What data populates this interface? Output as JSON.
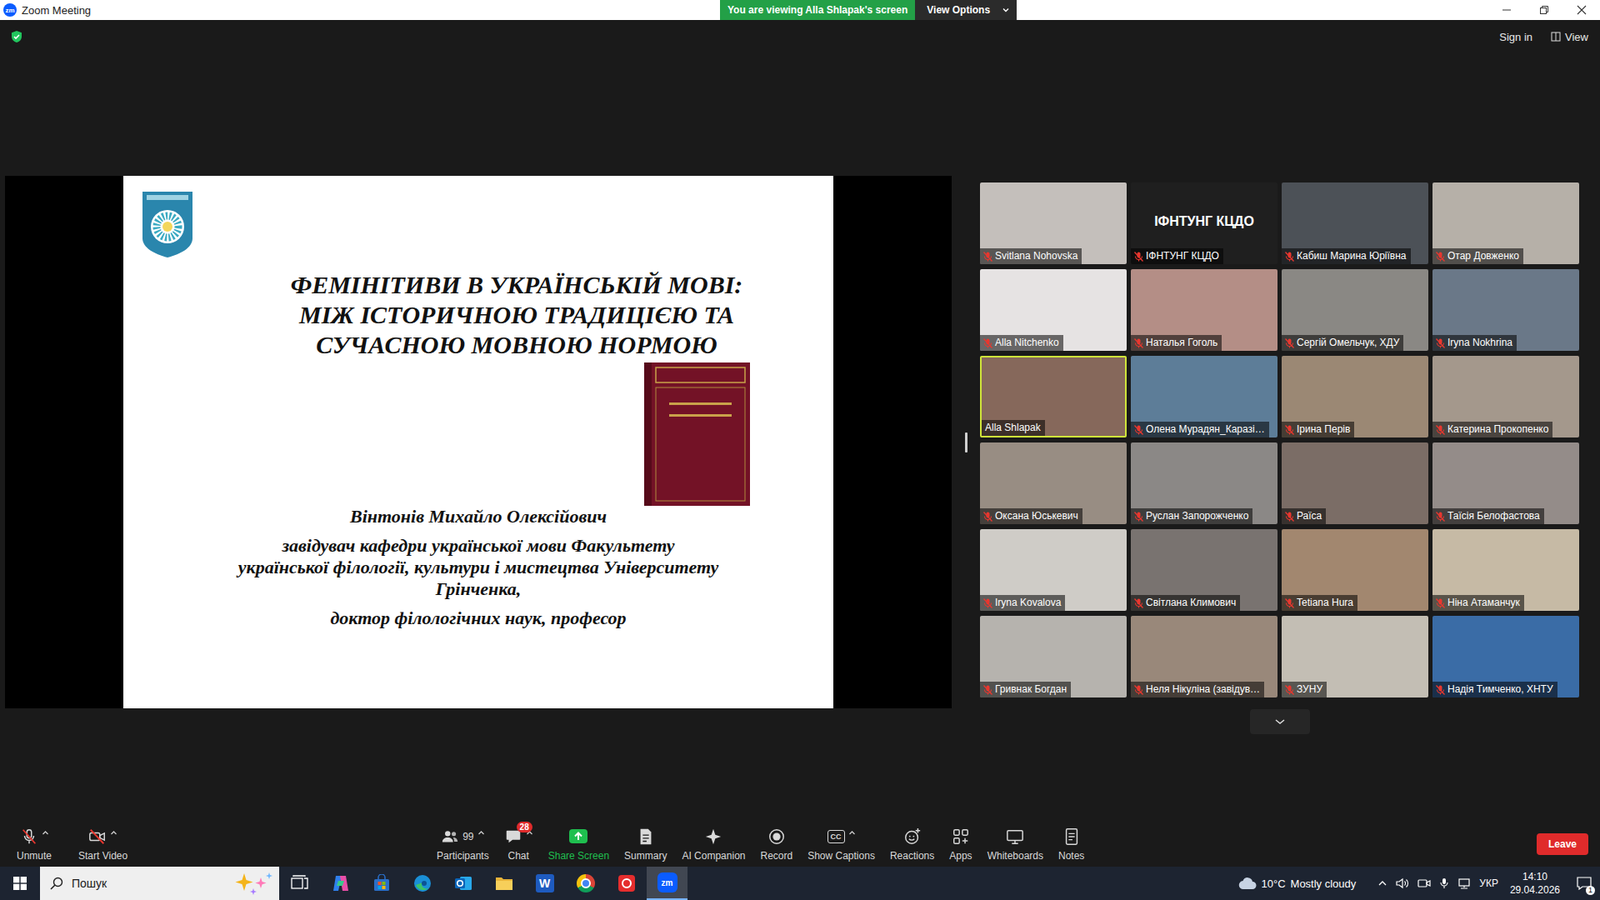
{
  "window": {
    "title": "Zoom Meeting",
    "app_icon": "zm"
  },
  "banner": {
    "text": "You are viewing Alla Shlapak's screen",
    "button": "View Options"
  },
  "top_right": {
    "sign_in": "Sign in",
    "view": "View"
  },
  "slide": {
    "title_lines": [
      "ФЕМІНІТИВИ В УКРАЇНСЬКІЙ МОВІ:",
      "МІЖ ІСТОРИЧНОЮ ТРАДИЦІЄЮ ТА",
      "СУЧАСНОЮ МОВНОЮ НОРМОЮ"
    ],
    "author": "Вінтонів Михайло Олексійович",
    "position_lines": [
      "завідувач кафедри української мови Факультету",
      "української філології, культури і мистецтва Університету",
      "Грінченка,"
    ],
    "degree": "доктор філологічних наук, професор"
  },
  "participants": [
    {
      "name": "Svitlana Nohovska",
      "muted": true,
      "video": true,
      "selected": false,
      "color": "#c4bfbb"
    },
    {
      "name": "ІФНТУНГ КЦДО",
      "muted": true,
      "video": false,
      "selected": false,
      "color": "#1f1f1f"
    },
    {
      "name": "Кабиш Марина Юріївна",
      "muted": true,
      "video": true,
      "selected": false,
      "color": "#4c5157"
    },
    {
      "name": "Отар Довженко",
      "muted": true,
      "video": true,
      "selected": false,
      "color": "#b6b0a8"
    },
    {
      "name": "Alla Nitchenko",
      "muted": true,
      "video": true,
      "selected": false,
      "color": "#e6e3e3"
    },
    {
      "name": "Наталья Гоголь",
      "muted": true,
      "video": true,
      "selected": false,
      "color": "#b48e86"
    },
    {
      "name": "Сергій Омельчук, ХДУ",
      "muted": true,
      "video": true,
      "selected": false,
      "color": "#8a8884"
    },
    {
      "name": "Iryna Nokhrina",
      "muted": true,
      "video": true,
      "selected": false,
      "color": "#6a7888"
    },
    {
      "name": "Alla Shlapak",
      "muted": false,
      "video": true,
      "selected": true,
      "color": "#86685b"
    },
    {
      "name": "Олена Мурадян_Каразі…",
      "muted": true,
      "video": true,
      "selected": false,
      "color": "#5d7d98"
    },
    {
      "name": "Ірина Перів",
      "muted": true,
      "video": true,
      "selected": false,
      "color": "#9b8874"
    },
    {
      "name": "Катерина Прокопенко",
      "muted": true,
      "video": true,
      "selected": false,
      "color": "#a4988c"
    },
    {
      "name": "Оксана Юськевич",
      "muted": true,
      "video": true,
      "selected": false,
      "color": "#988d83"
    },
    {
      "name": "Руслан Запорожченко",
      "muted": true,
      "video": true,
      "selected": false,
      "color": "#8b8886"
    },
    {
      "name": "Раїса",
      "muted": true,
      "video": true,
      "selected": false,
      "color": "#7b6d66"
    },
    {
      "name": "Таїсія Белофастова",
      "muted": true,
      "video": true,
      "selected": false,
      "color": "#948c89"
    },
    {
      "name": "Iryna Kovalova",
      "muted": true,
      "video": true,
      "selected": false,
      "color": "#cfccc7"
    },
    {
      "name": "Світлана Климович",
      "muted": true,
      "video": true,
      "selected": false,
      "color": "#797370"
    },
    {
      "name": "Tetiana Hura",
      "muted": true,
      "video": true,
      "selected": false,
      "color": "#a2876f"
    },
    {
      "name": "Ніна Атаманчук",
      "muted": true,
      "video": true,
      "selected": false,
      "color": "#c6baa5"
    },
    {
      "name": "Гривнак Богдан",
      "muted": true,
      "video": true,
      "selected": false,
      "color": "#b6b3ae"
    },
    {
      "name": "Неля Нікуліна (завідув…",
      "muted": true,
      "video": true,
      "selected": false,
      "color": "#99887a"
    },
    {
      "name": "ЗУНУ",
      "muted": true,
      "video": true,
      "selected": false,
      "color": "#c3beb4"
    },
    {
      "name": "Надія Тимченко, ХНТУ",
      "muted": true,
      "video": true,
      "selected": false,
      "color": "#3a6ca6"
    }
  ],
  "toolbar": {
    "items": [
      {
        "label": "Unmute",
        "kind": "mic",
        "caret": true,
        "off": true
      },
      {
        "label": "Start Video",
        "kind": "video",
        "caret": true,
        "off": true
      },
      {
        "label": "Participants",
        "kind": "participants",
        "caret": true,
        "off": false,
        "count": "99"
      },
      {
        "label": "Chat",
        "kind": "chat",
        "caret": true,
        "off": false,
        "badge": "28"
      },
      {
        "label": "Share Screen",
        "kind": "share",
        "caret": false,
        "off": false,
        "color": "#1fbf4f"
      },
      {
        "label": "Summary",
        "kind": "summary",
        "caret": false,
        "off": false
      },
      {
        "label": "AI Companion",
        "kind": "ai",
        "caret": false,
        "off": false
      },
      {
        "label": "Record",
        "kind": "record",
        "caret": false,
        "off": false
      },
      {
        "label": "Show Captions",
        "kind": "captions",
        "caret": true,
        "off": false,
        "glyph": "CC"
      },
      {
        "label": "Reactions",
        "kind": "reactions",
        "caret": false,
        "off": false
      },
      {
        "label": "Apps",
        "kind": "apps",
        "caret": false,
        "off": false
      },
      {
        "label": "Whiteboards",
        "kind": "whiteboards",
        "caret": false,
        "off": false
      },
      {
        "label": "Notes",
        "kind": "notes",
        "caret": false,
        "off": false
      }
    ],
    "leave": {
      "label": "Leave",
      "color": "#e02b2b"
    }
  },
  "taskbar": {
    "search_placeholder": "Пошук",
    "apps": [
      {
        "kind": "taskview",
        "selected": false
      },
      {
        "kind": "copilot",
        "selected": false
      },
      {
        "kind": "store",
        "selected": false
      },
      {
        "kind": "edge",
        "selected": false
      },
      {
        "kind": "outlook",
        "selected": false
      },
      {
        "kind": "files",
        "selected": false
      },
      {
        "kind": "word",
        "selected": false,
        "glyph": "W"
      },
      {
        "kind": "chrome",
        "selected": false
      },
      {
        "kind": "wps",
        "selected": false
      },
      {
        "kind": "zoom",
        "selected": true,
        "glyph": "zm"
      }
    ],
    "weather": {
      "temp": "10°C",
      "condition": "Mostly cloudy"
    },
    "language": "УКР",
    "time": "14:10",
    "date": "29.04.2026",
    "notifications": "1"
  }
}
